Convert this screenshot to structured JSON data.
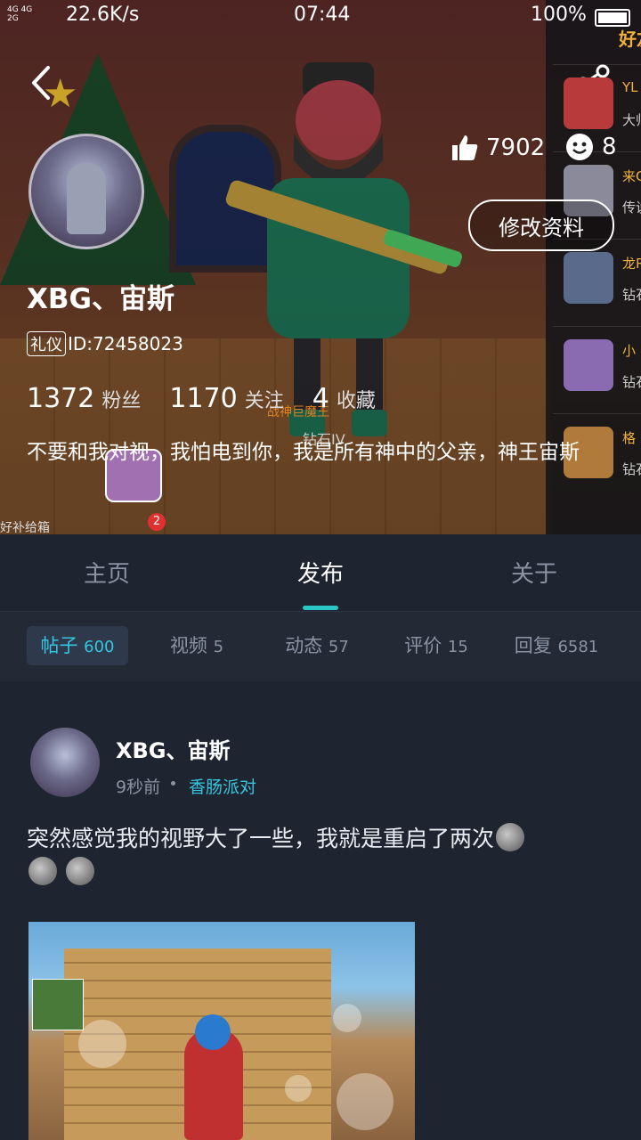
{
  "status_bar": {
    "network": "4G 4G\n2G",
    "speed": "22.6K/s",
    "time": "07:44",
    "battery": "100%"
  },
  "profile": {
    "username": "XBG、宙斯",
    "id_tag": "礼仪",
    "id_text": "ID:72458023",
    "followers_count": "1372",
    "followers_label": "粉丝",
    "following_count": "1170",
    "following_label": "关注",
    "favorites_count": "4",
    "favorites_label": "收藏",
    "bio": "不要和我对视，我怕电到你，我是所有神中的父亲，神王宙斯",
    "likes": "7902",
    "smiles": "8",
    "edit_button": "修改资料",
    "game_badge": "钻石IV",
    "game_title": "战神巨魔王",
    "notif_count": "2",
    "bottom_text": "好补给箱"
  },
  "friends_panel": {
    "title": "好友",
    "items": [
      {
        "name": "YL",
        "sub": "大帅",
        "color": "#b83a3a"
      },
      {
        "name": "来C",
        "sub": "传说",
        "color": "#8a8a9a"
      },
      {
        "name": "龙R",
        "sub": "钻石",
        "color": "#5a6a8a"
      },
      {
        "name": "小",
        "sub": "钻石",
        "color": "#8a6ab0"
      },
      {
        "name": "格",
        "sub": "钻石",
        "color": "#b07a3a"
      }
    ]
  },
  "tabs": [
    {
      "label": "主页"
    },
    {
      "label": "发布"
    },
    {
      "label": "关于"
    }
  ],
  "subtabs": [
    {
      "label": "帖子",
      "count": "600"
    },
    {
      "label": "视频",
      "count": "5"
    },
    {
      "label": "动态",
      "count": "57"
    },
    {
      "label": "评价",
      "count": "15"
    },
    {
      "label": "回复",
      "count": "6581"
    }
  ],
  "post": {
    "author": "XBG、宙斯",
    "time": "9秒前",
    "game": "香肠派对",
    "text": "突然感觉我的视野大了一些，我就是重启了两次"
  }
}
